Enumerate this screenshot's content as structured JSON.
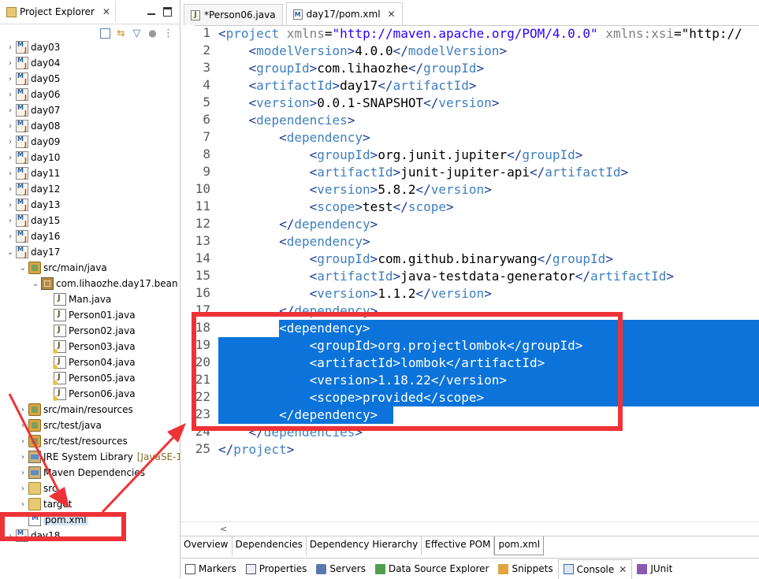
{
  "project_explorer": {
    "title": "Project Explorer",
    "close_label": "✕",
    "tree": [
      {
        "label": "day03",
        "kind": "project",
        "expanded": false
      },
      {
        "label": "day04",
        "kind": "project",
        "expanded": false
      },
      {
        "label": "day05",
        "kind": "project",
        "expanded": false
      },
      {
        "label": "day06",
        "kind": "project",
        "expanded": false
      },
      {
        "label": "day07",
        "kind": "project",
        "expanded": false
      },
      {
        "label": "day08",
        "kind": "project",
        "expanded": false
      },
      {
        "label": "day09",
        "kind": "project",
        "expanded": false
      },
      {
        "label": "day10",
        "kind": "project",
        "expanded": false
      },
      {
        "label": "day11",
        "kind": "project",
        "expanded": false
      },
      {
        "label": "day12",
        "kind": "project",
        "expanded": false
      },
      {
        "label": "day13",
        "kind": "project",
        "expanded": false
      },
      {
        "label": "day15",
        "kind": "project",
        "expanded": false
      },
      {
        "label": "day16",
        "kind": "project",
        "expanded": false
      },
      {
        "label": "day17",
        "kind": "project",
        "expanded": true
      },
      {
        "label": "src/main/java",
        "kind": "source-folder",
        "expanded": true
      },
      {
        "label": "com.lihaozhe.day17.bean",
        "kind": "package",
        "expanded": true
      },
      {
        "label": "Man.java",
        "kind": "java-file"
      },
      {
        "label": "Person01.java",
        "kind": "java-file"
      },
      {
        "label": "Person02.java",
        "kind": "java-file"
      },
      {
        "label": "Person03.java",
        "kind": "java-file"
      },
      {
        "label": "Person04.java",
        "kind": "java-file"
      },
      {
        "label": "Person05.java",
        "kind": "java-file"
      },
      {
        "label": "Person06.java",
        "kind": "java-file"
      },
      {
        "label": "src/main/resources",
        "kind": "source-folder",
        "expanded": false
      },
      {
        "label": "src/test/java",
        "kind": "source-folder",
        "expanded": false
      },
      {
        "label": "src/test/resources",
        "kind": "source-folder",
        "expanded": false
      },
      {
        "label": "JRE System Library",
        "suffix": "[JavaSE-1",
        "kind": "library",
        "expanded": false
      },
      {
        "label": "Maven Dependencies",
        "kind": "library",
        "expanded": false
      },
      {
        "label": "src",
        "kind": "folder",
        "expanded": false
      },
      {
        "label": "target",
        "kind": "folder",
        "expanded": false
      },
      {
        "label": "pom.xml",
        "kind": "xml-file",
        "selected": true
      },
      {
        "label": "day18",
        "kind": "project",
        "expanded": false
      }
    ]
  },
  "editor": {
    "tabs": [
      {
        "label": "*Person06.java",
        "active": false
      },
      {
        "label": "day17/pom.xml",
        "active": true
      }
    ],
    "close_label": "✕",
    "selected_lines": [
      18,
      23
    ],
    "lines": [
      "<project xmlns=\"http://maven.apache.org/POM/4.0.0\" xmlns:xsi=\"http://",
      "    <modelVersion>4.0.0</modelVersion>",
      "    <groupId>com.lihaozhe</groupId>",
      "    <artifactId>day17</artifactId>",
      "    <version>0.0.1-SNAPSHOT</version>",
      "    <dependencies>",
      "        <dependency>",
      "            <groupId>org.junit.jupiter</groupId>",
      "            <artifactId>junit-jupiter-api</artifactId>",
      "            <version>5.8.2</version>",
      "            <scope>test</scope>",
      "        </dependency>",
      "        <dependency>",
      "            <groupId>com.github.binarywang</groupId>",
      "            <artifactId>java-testdata-generator</artifactId>",
      "            <version>1.1.2</version>",
      "        </dependency>",
      "        <dependency>",
      "            <groupId>org.projectlombok</groupId>",
      "            <artifactId>lombok</artifactId>",
      "            <version>1.18.22</version>",
      "            <scope>provided</scope>",
      "        </dependency>",
      "    </dependencies>",
      "</project>"
    ],
    "pom_tabs": [
      {
        "label": "Overview",
        "active": false
      },
      {
        "label": "Dependencies",
        "active": false
      },
      {
        "label": "Dependency Hierarchy",
        "active": false
      },
      {
        "label": "Effective POM",
        "active": false
      },
      {
        "label": "pom.xml",
        "active": true
      }
    ]
  },
  "bottom_panel": {
    "tabs": [
      {
        "label": "Markers",
        "icon": "markers-icon"
      },
      {
        "label": "Properties",
        "icon": "properties-icon"
      },
      {
        "label": "Servers",
        "icon": "servers-icon"
      },
      {
        "label": "Data Source Explorer",
        "icon": "data-source-icon"
      },
      {
        "label": "Snippets",
        "icon": "snippets-icon"
      },
      {
        "label": "Console",
        "icon": "console-icon",
        "active": true
      },
      {
        "label": "JUnit",
        "icon": "junit-icon"
      }
    ]
  },
  "colors": {
    "selection": "#0b73d9",
    "annotation_red": "#ee3338",
    "xml_tag": "#3f7fbf",
    "xml_attr_value": "#2a00ff"
  }
}
